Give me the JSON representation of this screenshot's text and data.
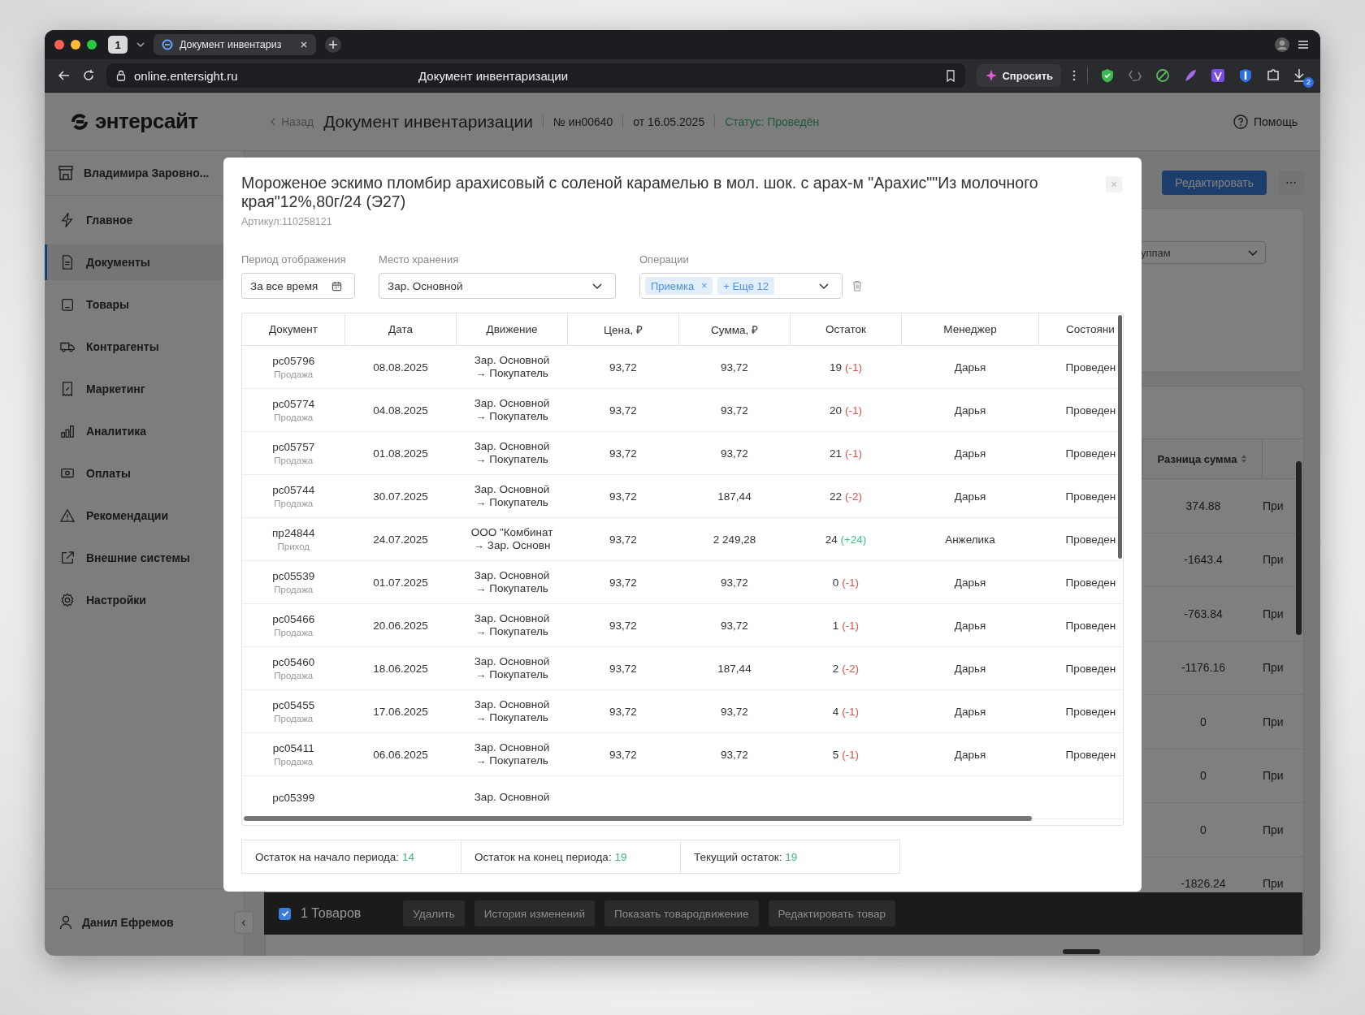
{
  "browser": {
    "tab_count": "1",
    "tab_title": "Документ инвентариз",
    "url": "online.entersight.ru",
    "page_title": "Документ инвентаризации",
    "ask_button": "Спросить",
    "downloads_badge": "2"
  },
  "header": {
    "logo": "энтерсайт",
    "back": "Назад",
    "title": "Документ инвентаризации",
    "number": "№ ин00640",
    "date": "от 16.05.2025",
    "status": "Статус: Проведён",
    "help": "Помощь"
  },
  "sidebar": {
    "store": "Владимира Заровно...",
    "items": [
      {
        "label": "Главное",
        "selected": false
      },
      {
        "label": "Документы",
        "selected": true
      },
      {
        "label": "Товары",
        "selected": false
      },
      {
        "label": "Контрагенты",
        "selected": false
      },
      {
        "label": "Маркетинг",
        "selected": false
      },
      {
        "label": "Аналитика",
        "selected": false
      },
      {
        "label": "Оплаты",
        "selected": false
      },
      {
        "label": "Рекомендации",
        "selected": false
      },
      {
        "label": "Внешние системы",
        "selected": false
      },
      {
        "label": "Настройки",
        "selected": false
      }
    ],
    "user": "Данил Ефремов",
    "collapse": "‹"
  },
  "background": {
    "edit_button": "Редактировать",
    "more_button": "⋯",
    "grouping_select": "уппам",
    "table": {
      "column": "Разница сумма",
      "rows": [
        {
          "difference": "374.88",
          "column_2": "При"
        },
        {
          "difference": "-1643.4",
          "column_2": "При"
        },
        {
          "difference": "-763.84",
          "column_2": "При"
        },
        {
          "difference": "-1176.16",
          "column_2": "При"
        },
        {
          "difference": "0",
          "column_2": "При"
        },
        {
          "difference": "0",
          "column_2": "При"
        },
        {
          "difference": "0",
          "column_2": "При"
        },
        {
          "difference": "-1826.24",
          "column_2": "При"
        }
      ]
    }
  },
  "modal": {
    "title": "Мороженое эскимо пломбир арахисовый с соленой карамелью в мол. шок. с арах-м \"Арахис\"\"Из молочного края\"12%,80г/24 (Э27)",
    "article": "Артикул:110258121",
    "close": "×",
    "filters": {
      "period_label": "Период отображения",
      "period_value": "За все время",
      "storage_label": "Место хранения",
      "storage_value": "Зар. Основной",
      "operations_label": "Операции",
      "operations_tags": [
        {
          "label": "Приемка",
          "remove": "×"
        }
      ],
      "operations_more": "+ Еще 12"
    },
    "table": {
      "columns": [
        "Документ",
        "Дата",
        "Движение",
        "Цена, ₽",
        "Сумма, ₽",
        "Остаток",
        "Менеджер",
        "Состояни"
      ],
      "rows": [
        {
          "document": "рс05796",
          "type": "Продажа",
          "date": "08.08.2025",
          "from": "Зар. Основной",
          "to": "→ Покупатель",
          "price": "93,72",
          "sum": "93,72",
          "stock": "19",
          "change": {
            "text": "(-1)",
            "color": "#d9534f"
          },
          "manager": "Дарья",
          "state": "Проведен"
        },
        {
          "document": "рс05774",
          "type": "Продажа",
          "date": "04.08.2025",
          "from": "Зар. Основной",
          "to": "→ Покупатель",
          "price": "93,72",
          "sum": "93,72",
          "stock": "20",
          "change": {
            "text": "(-1)",
            "color": "#d9534f"
          },
          "manager": "Дарья",
          "state": "Проведен"
        },
        {
          "document": "рс05757",
          "type": "Продажа",
          "date": "01.08.2025",
          "from": "Зар. Основной",
          "to": "→ Покупатель",
          "price": "93,72",
          "sum": "93,72",
          "stock": "21",
          "change": {
            "text": "(-1)",
            "color": "#d9534f"
          },
          "manager": "Дарья",
          "state": "Проведен"
        },
        {
          "document": "рс05744",
          "type": "Продажа",
          "date": "30.07.2025",
          "from": "Зар. Основной",
          "to": "→ Покупатель",
          "price": "93,72",
          "sum": "187,44",
          "stock": "22",
          "change": {
            "text": "(-2)",
            "color": "#d9534f"
          },
          "manager": "Дарья",
          "state": "Проведен"
        },
        {
          "document": "пр24844",
          "type": "Приход",
          "date": "24.07.2025",
          "from": "ООО \"Комбинат",
          "to": "→ Зар. Основн",
          "price": "93,72",
          "sum": "2 249,28",
          "stock": "24",
          "change": {
            "text": "(+24)",
            "color": "#3fc47f"
          },
          "manager": "Анжелика",
          "state": "Проведен"
        },
        {
          "document": "рс05539",
          "type": "Продажа",
          "date": "01.07.2025",
          "from": "Зар. Основной",
          "to": "→ Покупатель",
          "price": "93,72",
          "sum": "93,72",
          "stock": "0",
          "change": {
            "text": "(-1)",
            "color": "#d9534f"
          },
          "manager": "Дарья",
          "state": "Проведен"
        },
        {
          "document": "рс05466",
          "type": "Продажа",
          "date": "20.06.2025",
          "from": "Зар. Основной",
          "to": "→ Покупатель",
          "price": "93,72",
          "sum": "93,72",
          "stock": "1",
          "change": {
            "text": "(-1)",
            "color": "#d9534f"
          },
          "manager": "Дарья",
          "state": "Проведен"
        },
        {
          "document": "рс05460",
          "type": "Продажа",
          "date": "18.06.2025",
          "from": "Зар. Основной",
          "to": "→ Покупатель",
          "price": "93,72",
          "sum": "187,44",
          "stock": "2",
          "change": {
            "text": "(-2)",
            "color": "#d9534f"
          },
          "manager": "Дарья",
          "state": "Проведен"
        },
        {
          "document": "рс05455",
          "type": "Продажа",
          "date": "17.06.2025",
          "from": "Зар. Основной",
          "to": "→ Покупатель",
          "price": "93,72",
          "sum": "93,72",
          "stock": "4",
          "change": {
            "text": "(-1)",
            "color": "#d9534f"
          },
          "manager": "Дарья",
          "state": "Проведен"
        },
        {
          "document": "рс05411",
          "type": "Продажа",
          "date": "06.06.2025",
          "from": "Зар. Основной",
          "to": "→ Покупатель",
          "price": "93,72",
          "sum": "93,72",
          "stock": "5",
          "change": {
            "text": "(-1)",
            "color": "#d9534f"
          },
          "manager": "Дарья",
          "state": "Проведен"
        },
        {
          "document": "рс05399",
          "from": "Зар. Основной"
        }
      ]
    },
    "summary": [
      {
        "label": "Остаток на начало периода:",
        "value": "14"
      },
      {
        "label": "Остаток на конец периода:",
        "value": "19"
      },
      {
        "label": "Текущий остаток:",
        "value": "19"
      }
    ]
  },
  "action_bar": {
    "checked": true,
    "count": "1 Товаров",
    "buttons": [
      "Удалить",
      "История изменений",
      "Показать товародвижение",
      "Редактировать товар"
    ]
  }
}
